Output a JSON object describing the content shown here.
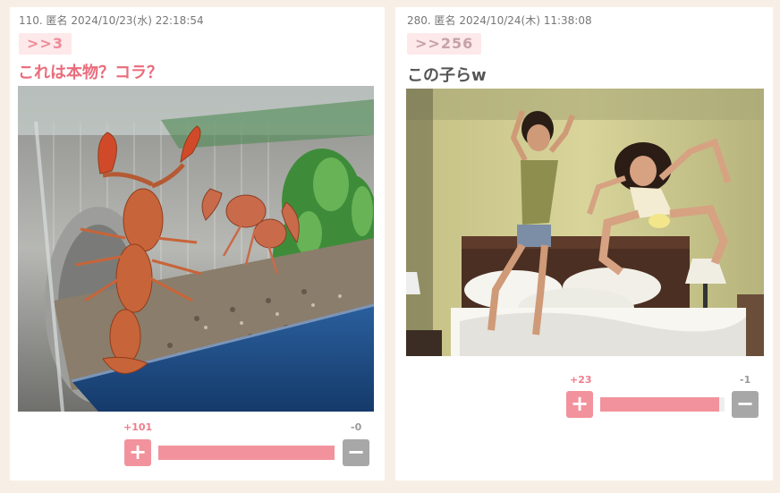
{
  "posts": [
    {
      "meta": "110. 匿名 2024/10/23(水) 22:18:54",
      "anchor": ">>3",
      "title": "これは本物？コラ？",
      "image": "crayfish-in-aquarium-photo",
      "votes": {
        "plus": "+101",
        "minus": "-0",
        "plus_ratio": 1.0
      }
    },
    {
      "meta": "280. 匿名 2024/10/24(木) 11:38:08",
      "anchor": ">>256",
      "title": "この子らw",
      "image": "two-girls-jumping-on-bed-photo",
      "votes": {
        "plus": "+23",
        "minus": "-1",
        "plus_ratio": 0.96
      }
    }
  ],
  "buttons": {
    "plus": "+",
    "minus": "−"
  },
  "colors": {
    "background": "#f7efe6",
    "accent": "#f2929c",
    "title_pink": "#ea6c7c",
    "minus_gray": "#a7a7a7"
  }
}
